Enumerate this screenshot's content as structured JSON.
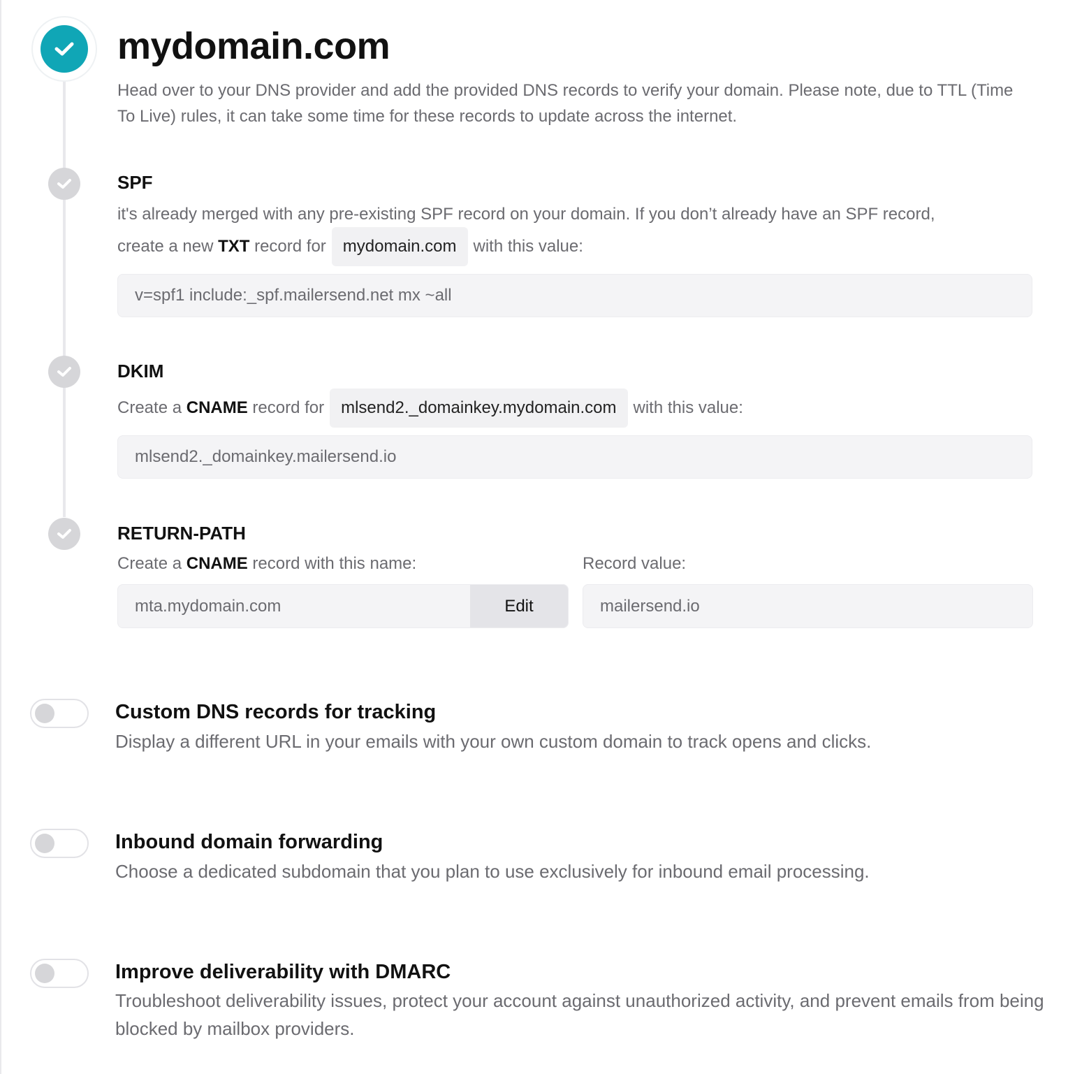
{
  "domain": {
    "title": "mydomain.com",
    "description": "Head over to your DNS provider and add the provided DNS records to verify your domain. Please note, due to TTL (Time To Live) rules, it can take some time for these records to update across the internet."
  },
  "spf": {
    "title": "SPF",
    "text_line1": "it's already merged with any pre-existing SPF record on your domain. If you don’t already have an SPF record,",
    "text_prefix": "create a new",
    "record_type": "TXT",
    "text_mid": "record for",
    "host": "mydomain.com",
    "text_suffix": "with this value:",
    "value": "v=spf1 include:_spf.mailersend.net mx ~all"
  },
  "dkim": {
    "title": "DKIM",
    "text_prefix": "Create a",
    "record_type": "CNAME",
    "text_mid": "record for",
    "host": "mlsend2._domainkey.mydomain.com",
    "text_suffix": "with this value:",
    "value": "mlsend2._domainkey.mailersend.io"
  },
  "return_path": {
    "title": "RETURN-PATH",
    "text_prefix": "Create a",
    "record_type": "CNAME",
    "text_suffix": "record with this name:",
    "name_value": "mta.mydomain.com",
    "edit_label": "Edit",
    "record_value_label": "Record value:",
    "record_value": "mailersend.io"
  },
  "options": [
    {
      "title": "Custom DNS records for tracking",
      "description": "Display a different URL in your emails with your own custom domain to track opens and clicks.",
      "enabled": false
    },
    {
      "title": "Inbound domain forwarding",
      "description": "Choose a dedicated subdomain that you plan to use exclusively for inbound email processing.",
      "enabled": false
    },
    {
      "title": "Improve deliverability with DMARC",
      "description": "Troubleshoot deliverability issues, protect your account against unauthorized activity, and prevent emails from being blocked by mailbox providers.",
      "enabled": false
    }
  ],
  "colors": {
    "accent": "#10a6b6",
    "step_done": "#d6d6d9"
  },
  "icons": {
    "main": "check-icon",
    "step": "check-icon"
  }
}
